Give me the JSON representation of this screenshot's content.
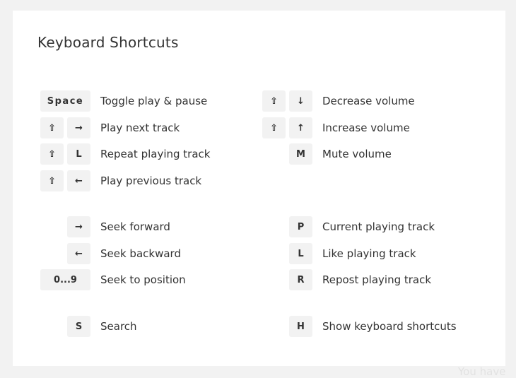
{
  "background": {
    "fragment": "You have"
  },
  "modal": {
    "title": "Keyboard Shortcuts",
    "shortcuts": [
      {
        "keys": [
          "Space"
        ],
        "label": "Toggle play & pause",
        "col": "left",
        "row": 0
      },
      {
        "keys": [
          "⇧",
          "→"
        ],
        "label": "Play next track",
        "col": "left",
        "row": 1
      },
      {
        "keys": [
          "⇧",
          "L"
        ],
        "label": "Repeat playing track",
        "col": "left",
        "row": 2
      },
      {
        "keys": [
          "⇧",
          "←"
        ],
        "label": "Play previous track",
        "col": "left",
        "row": 3
      },
      {
        "keys": [
          "→"
        ],
        "label": "Seek forward",
        "col": "left",
        "row": 4
      },
      {
        "keys": [
          "←"
        ],
        "label": "Seek backward",
        "col": "left",
        "row": 5
      },
      {
        "keys": [
          "0...9"
        ],
        "label": "Seek to position",
        "col": "left",
        "row": 6
      },
      {
        "keys": [
          "S"
        ],
        "label": "Search",
        "col": "left",
        "row": 7
      },
      {
        "keys": [
          "⇧",
          "↓"
        ],
        "label": "Decrease volume",
        "col": "right",
        "row": 0
      },
      {
        "keys": [
          "⇧",
          "↑"
        ],
        "label": "Increase volume",
        "col": "right",
        "row": 1
      },
      {
        "keys": [
          "M"
        ],
        "label": "Mute volume",
        "col": "right",
        "row": 2
      },
      {
        "keys": [
          "P"
        ],
        "label": "Current playing track",
        "col": "right",
        "row": 4
      },
      {
        "keys": [
          "L"
        ],
        "label": "Like playing track",
        "col": "right",
        "row": 5
      },
      {
        "keys": [
          "R"
        ],
        "label": "Repost playing track",
        "col": "right",
        "row": 6
      },
      {
        "keys": [
          "H"
        ],
        "label": "Show keyboard shortcuts",
        "col": "right",
        "row": 7
      }
    ]
  }
}
